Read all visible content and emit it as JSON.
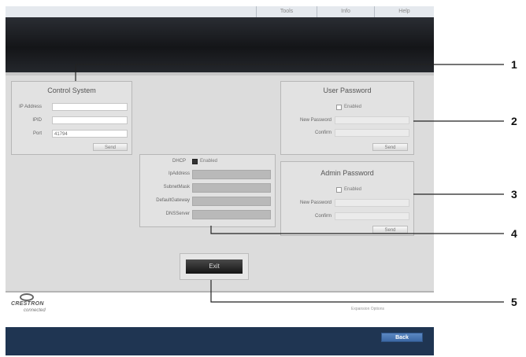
{
  "top_menu": [
    "Tools",
    "Info",
    "Help"
  ],
  "control_system": {
    "title": "Control System",
    "ip_label": "IP Address",
    "ip_value": "",
    "ipid_label": "IPID",
    "ipid_value": "",
    "port_label": "Port",
    "port_value": "41794",
    "send_label": "Send"
  },
  "user_password": {
    "title": "User Password",
    "enabled_label": "Enabled",
    "enabled": false,
    "new_label": "New Password",
    "confirm_label": "Confirm",
    "send_label": "Send"
  },
  "admin_password": {
    "title": "Admin Password",
    "enabled_label": "Enabled",
    "enabled": false,
    "new_label": "New Password",
    "confirm_label": "Confirm",
    "send_label": "Send"
  },
  "network": {
    "dhcp_label": "DHCP",
    "dhcp_enabled_label": "Enabled",
    "dhcp_enabled": true,
    "ip_label": "IpAddress",
    "subnet_label": "SubnetMask",
    "gateway_label": "DefaultGateway",
    "dns_label": "DNSServer"
  },
  "exit_label": "Exit",
  "logo": {
    "name": "CRESTRON",
    "sub": "connected"
  },
  "expansion_label": "Expansion Options",
  "back_label": "Back",
  "callouts": [
    "1",
    "2",
    "3",
    "4",
    "5"
  ],
  "colors": {
    "frame": "#1f3552",
    "back_button": "#4a78b6",
    "content": "#dcdcdc"
  }
}
